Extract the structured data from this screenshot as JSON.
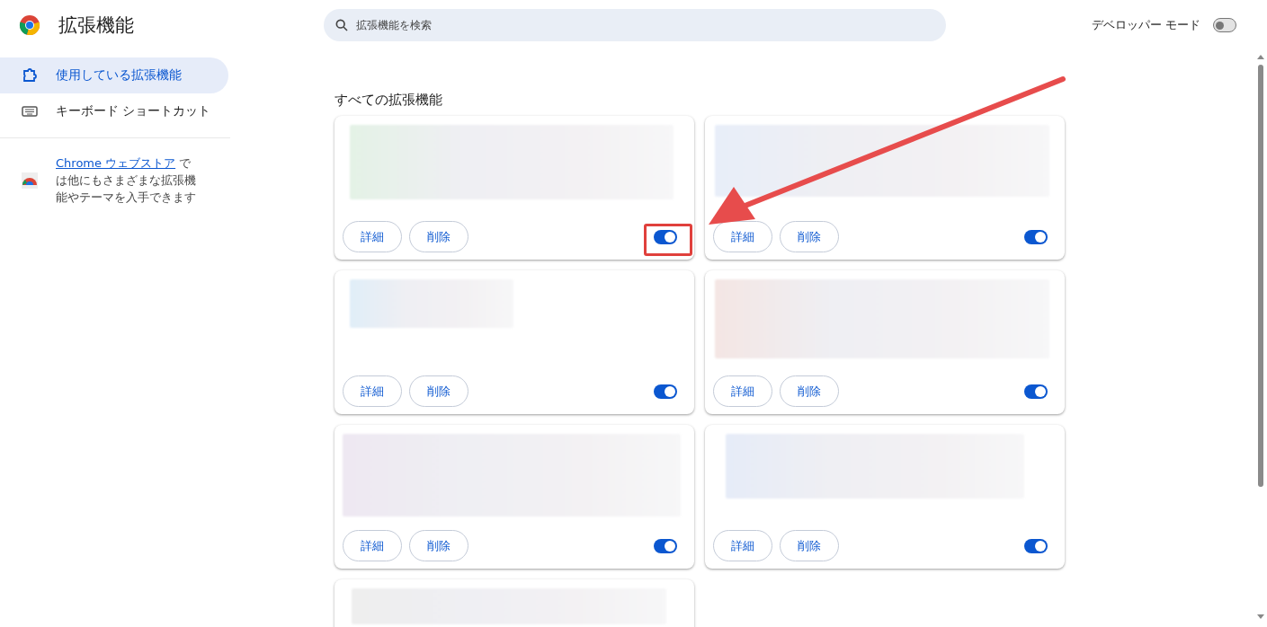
{
  "header": {
    "title": "拡張機能",
    "search": {
      "placeholder": "拡張機能を検索"
    },
    "developer_mode": {
      "label": "デベロッパー モード",
      "on": false
    }
  },
  "sidebar": {
    "items": [
      {
        "label": "使用している拡張機能",
        "kind": "puzzle",
        "selected": true
      },
      {
        "label": "キーボード ショートカット",
        "kind": "keyboard",
        "selected": false
      }
    ],
    "store_note": {
      "link": "Chrome ウェブストア",
      "text": " では他にもさまざまな拡張機能やテーマを入手できます"
    }
  },
  "section_title": "すべての拡張機能",
  "cards": [
    {
      "kind": "full",
      "details": "詳細",
      "remove": "削除",
      "enabled": true,
      "highlighted": true
    },
    {
      "kind": "full",
      "details": "詳細",
      "remove": "削除",
      "enabled": true,
      "highlighted": false
    },
    {
      "kind": "full",
      "details": "詳細",
      "remove": "削除",
      "enabled": true,
      "highlighted": false
    },
    {
      "kind": "full",
      "details": "詳細",
      "remove": "削除",
      "enabled": true,
      "highlighted": false
    },
    {
      "kind": "full",
      "details": "詳細",
      "remove": "削除",
      "enabled": true,
      "highlighted": false
    },
    {
      "kind": "full",
      "details": "詳細",
      "remove": "削除",
      "enabled": true,
      "highlighted": false
    },
    {
      "kind": "partial"
    }
  ]
}
